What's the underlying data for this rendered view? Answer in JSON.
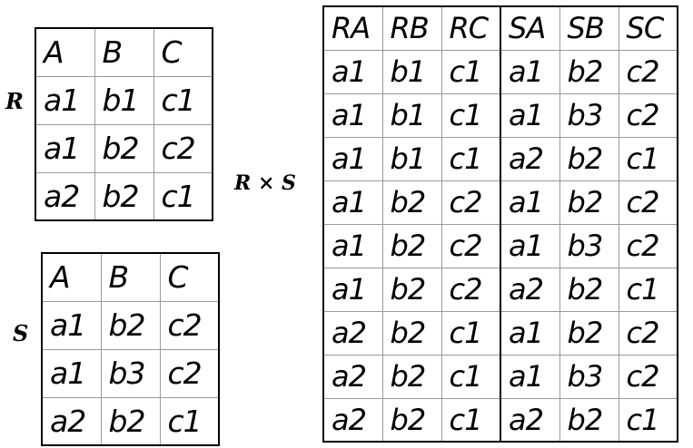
{
  "labels": {
    "r": "R",
    "s": "S",
    "product": "R × S"
  },
  "R": {
    "header": [
      "A",
      "B",
      "C"
    ],
    "rows": [
      [
        "a1",
        "b1",
        "c1"
      ],
      [
        "a1",
        "b2",
        "c2"
      ],
      [
        "a2",
        "b2",
        "c1"
      ]
    ]
  },
  "S": {
    "header": [
      "A",
      "B",
      "C"
    ],
    "rows": [
      [
        "a1",
        "b2",
        "c2"
      ],
      [
        "a1",
        "b3",
        "c2"
      ],
      [
        "a2",
        "b2",
        "c1"
      ]
    ]
  },
  "RxS": {
    "header": [
      "RA",
      "RB",
      "RC",
      "SA",
      "SB",
      "SC"
    ],
    "rows": [
      [
        "a1",
        "b1",
        "c1",
        "a1",
        "b2",
        "c2"
      ],
      [
        "a1",
        "b1",
        "c1",
        "a1",
        "b3",
        "c2"
      ],
      [
        "a1",
        "b1",
        "c1",
        "a2",
        "b2",
        "c1"
      ],
      [
        "a1",
        "b2",
        "c2",
        "a1",
        "b2",
        "c2"
      ],
      [
        "a1",
        "b2",
        "c2",
        "a1",
        "b3",
        "c2"
      ],
      [
        "a1",
        "b2",
        "c2",
        "a2",
        "b2",
        "c1"
      ],
      [
        "a2",
        "b2",
        "c1",
        "a1",
        "b2",
        "c2"
      ],
      [
        "a2",
        "b2",
        "c1",
        "a1",
        "b3",
        "c2"
      ],
      [
        "a2",
        "b2",
        "c1",
        "a2",
        "b2",
        "c1"
      ]
    ]
  }
}
